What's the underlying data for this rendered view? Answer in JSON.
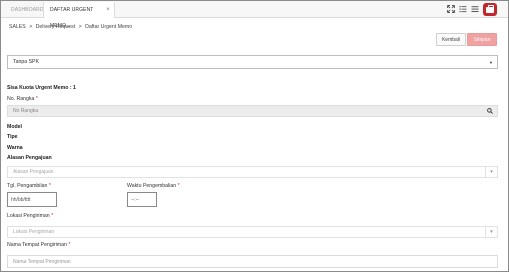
{
  "tabs": [
    {
      "label": "DASHBOARD"
    },
    {
      "label": "DAFTAR URGENT MEMO..."
    }
  ],
  "topbar": {
    "icons": [
      "expand-icon",
      "list-icon",
      "menu-icon",
      "briefcase-icon"
    ]
  },
  "breadcrumb": [
    "SALES",
    ">",
    "Delivery Request",
    ">",
    "Daftar Urgent Memo"
  ],
  "actions": {
    "back_label": "Kembali",
    "save_label": "Simpan"
  },
  "spk_select": {
    "value": "Tanpa SPK"
  },
  "quota_label": "Sisa Kuota Urgent Memo : 1",
  "rangka": {
    "label": "No. Rangka",
    "required_mark": "*",
    "placeholder": "No Rangka"
  },
  "info": {
    "model_label": "Model",
    "tipe_label": "Tipe",
    "warna_label": "Warna",
    "alasan_label": "Alasan Pengajuan"
  },
  "alasan_select": {
    "placeholder": "Alasan Pengajuan"
  },
  "tgl_pengambilan": {
    "label": "Tgl. Pengambilan",
    "required_mark": "*",
    "value": "hh/bb/tttt"
  },
  "waktu_pengembalian": {
    "label": "Waktu Pengembalian",
    "required_mark": "*",
    "value": "--:--"
  },
  "lokasi": {
    "label": "Lokasi Pengiriman",
    "required_mark": "*",
    "placeholder": "Lokasi Pengiriman"
  },
  "nama_tempat": {
    "label": "Nama Tempat Pengiriman",
    "required_mark": "*",
    "placeholder": "Nama Tempat Pengiriman"
  },
  "colors": {
    "brand_red": "#c0282d",
    "save_button": "#f0a1a1"
  }
}
